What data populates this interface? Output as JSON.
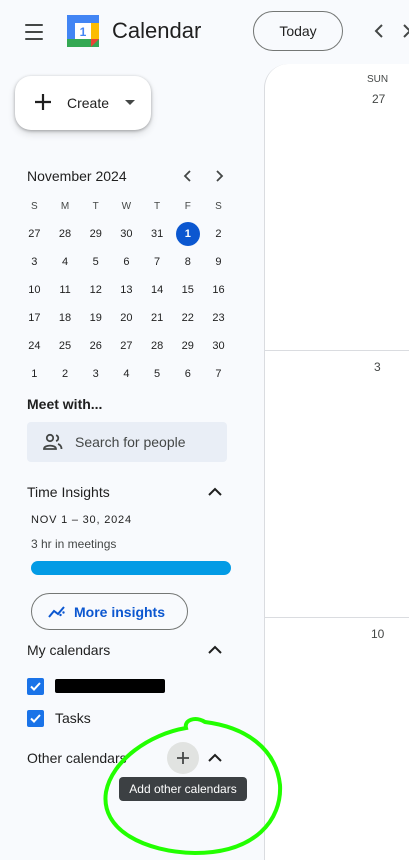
{
  "header": {
    "app_title": "Calendar",
    "logo_day": "1",
    "today_label": "Today",
    "icons": [
      "menu-icon",
      "calendar-logo",
      "chevron-left-icon",
      "chevron-right-icon"
    ]
  },
  "create": {
    "label": "Create"
  },
  "mini_calendar": {
    "title": "November 2024",
    "weekdays": [
      "S",
      "M",
      "T",
      "W",
      "T",
      "F",
      "S"
    ],
    "weeks": [
      [
        "27",
        "28",
        "29",
        "30",
        "31",
        "1",
        "2"
      ],
      [
        "3",
        "4",
        "5",
        "6",
        "7",
        "8",
        "9"
      ],
      [
        "10",
        "11",
        "12",
        "13",
        "14",
        "15",
        "16"
      ],
      [
        "17",
        "18",
        "19",
        "20",
        "21",
        "22",
        "23"
      ],
      [
        "24",
        "25",
        "26",
        "27",
        "28",
        "29",
        "30"
      ],
      [
        "1",
        "2",
        "3",
        "4",
        "5",
        "6",
        "7"
      ]
    ],
    "selected": "1"
  },
  "meet": {
    "title": "Meet with...",
    "search_placeholder": "Search for people"
  },
  "time_insights": {
    "title": "Time Insights",
    "range": "NOV 1 – 30, 2024",
    "meetings": "3 hr in meetings",
    "more_label": "More insights",
    "bar_fill": 1.0
  },
  "my_calendars": {
    "title": "My calendars",
    "items": [
      {
        "label": "",
        "checked": true,
        "redacted": true
      },
      {
        "label": "Tasks",
        "checked": true
      }
    ]
  },
  "other_calendars": {
    "title": "Other calendars",
    "tooltip": "Add other calendars"
  },
  "main": {
    "day_name": "SUN",
    "dates": [
      "27",
      "3",
      "10"
    ]
  },
  "colors": {
    "accent": "#0b57d0",
    "checkbox": "#1a73e8",
    "insight_bar": "#039be5",
    "annotation": "#22ff00"
  }
}
